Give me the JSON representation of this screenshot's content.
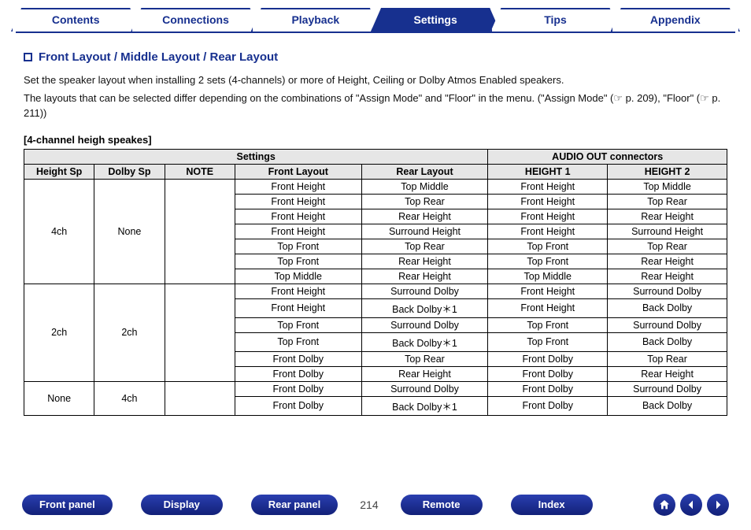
{
  "nav": {
    "tabs": [
      "Contents",
      "Connections",
      "Playback",
      "Settings",
      "Tips",
      "Appendix"
    ],
    "active": "Settings"
  },
  "section": {
    "title": "Front Layout / Middle Layout / Rear Layout",
    "para1": "Set the speaker layout when installing 2 sets (4-channels) or more of Height, Ceiling or Dolby Atmos Enabled speakers.",
    "para2": "The layouts that can be selected differ depending on the combinations of \"Assign Mode\" and \"Floor\" in the menu. (\"Assign Mode\" (☞ p. 209), \"Floor\" (☞ p. 211))",
    "sublabel": "[4-channel heigh speakes]"
  },
  "table": {
    "group_headers": [
      "Settings",
      "AUDIO OUT connectors"
    ],
    "columns": [
      "Height Sp",
      "Dolby Sp",
      "NOTE",
      "Front Layout",
      "Rear Layout",
      "HEIGHT 1",
      "HEIGHT 2"
    ],
    "groups": [
      {
        "height_sp": "4ch",
        "dolby_sp": "None",
        "note": "",
        "rows": [
          [
            "Front Height",
            "Top Middle",
            "Front Height",
            "Top Middle"
          ],
          [
            "Front Height",
            "Top Rear",
            "Front Height",
            "Top Rear"
          ],
          [
            "Front Height",
            "Rear Height",
            "Front Height",
            "Rear Height"
          ],
          [
            "Front Height",
            "Surround Height",
            "Front Height",
            "Surround Height"
          ],
          [
            "Top Front",
            "Top Rear",
            "Top Front",
            "Top Rear"
          ],
          [
            "Top Front",
            "Rear Height",
            "Top Front",
            "Rear Height"
          ],
          [
            "Top Middle",
            "Rear Height",
            "Top Middle",
            "Rear Height"
          ]
        ]
      },
      {
        "height_sp": "2ch",
        "dolby_sp": "2ch",
        "note": "",
        "rows": [
          [
            "Front Height",
            "Surround Dolby",
            "Front Height",
            "Surround Dolby"
          ],
          [
            "Front Height",
            "Back Dolby＊1",
            "Front Height",
            "Back Dolby"
          ],
          [
            "Top Front",
            "Surround Dolby",
            "Top Front",
            "Surround Dolby"
          ],
          [
            "Top Front",
            "Back Dolby＊1",
            "Top Front",
            "Back Dolby"
          ],
          [
            "Front Dolby",
            "Top Rear",
            "Front Dolby",
            "Top Rear"
          ],
          [
            "Front Dolby",
            "Rear Height",
            "Front Dolby",
            "Rear Height"
          ]
        ]
      },
      {
        "height_sp": "None",
        "dolby_sp": "4ch",
        "note": "",
        "rows": [
          [
            "Front Dolby",
            "Surround Dolby",
            "Front Dolby",
            "Surround Dolby"
          ],
          [
            "Front Dolby",
            "Back Dolby＊1",
            "Front Dolby",
            "Back Dolby"
          ]
        ]
      }
    ]
  },
  "footer": {
    "buttons": [
      "Front panel",
      "Display",
      "Rear panel",
      "Remote",
      "Index"
    ],
    "page": "214"
  }
}
